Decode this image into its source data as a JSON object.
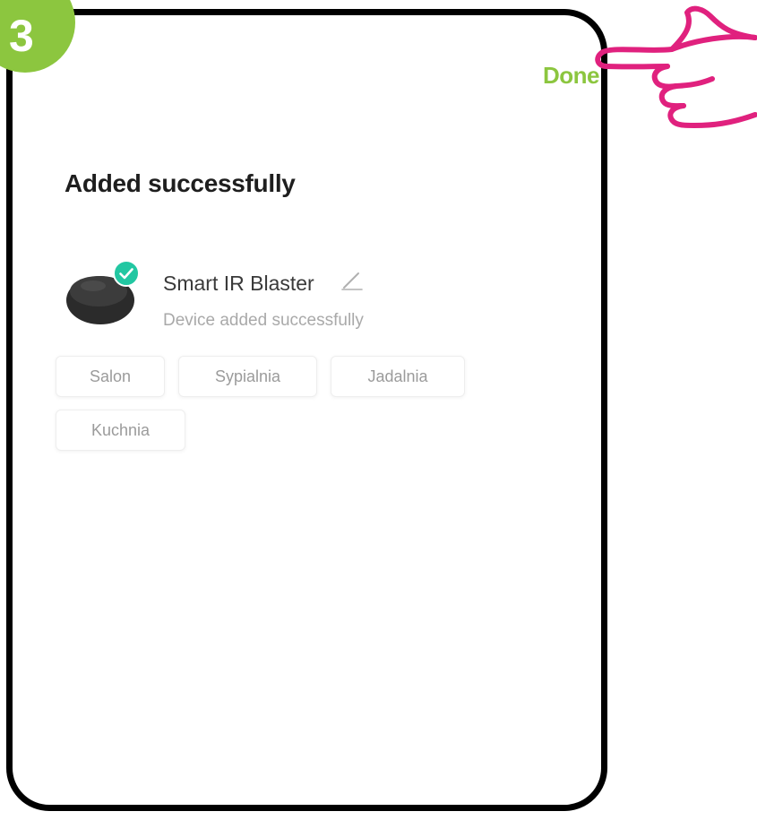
{
  "step": {
    "number": "3",
    "color": "#8cc63f"
  },
  "header": {
    "done_label": "Done"
  },
  "page": {
    "title": "Added successfully"
  },
  "device": {
    "name": "Smart IR Blaster",
    "status": "Device added successfully",
    "image_icon": "ir-blaster-device-icon",
    "check_icon": "check-badge-icon",
    "edit_icon": "pencil-icon"
  },
  "rooms": [
    {
      "label": "Salon"
    },
    {
      "label": "Sypialnia"
    },
    {
      "label": "Jadalnia"
    },
    {
      "label": "Kuchnia"
    }
  ],
  "colors": {
    "accent_green": "#8cc63f",
    "check_teal": "#22c7a2",
    "pointer_magenta": "#e0217e"
  }
}
